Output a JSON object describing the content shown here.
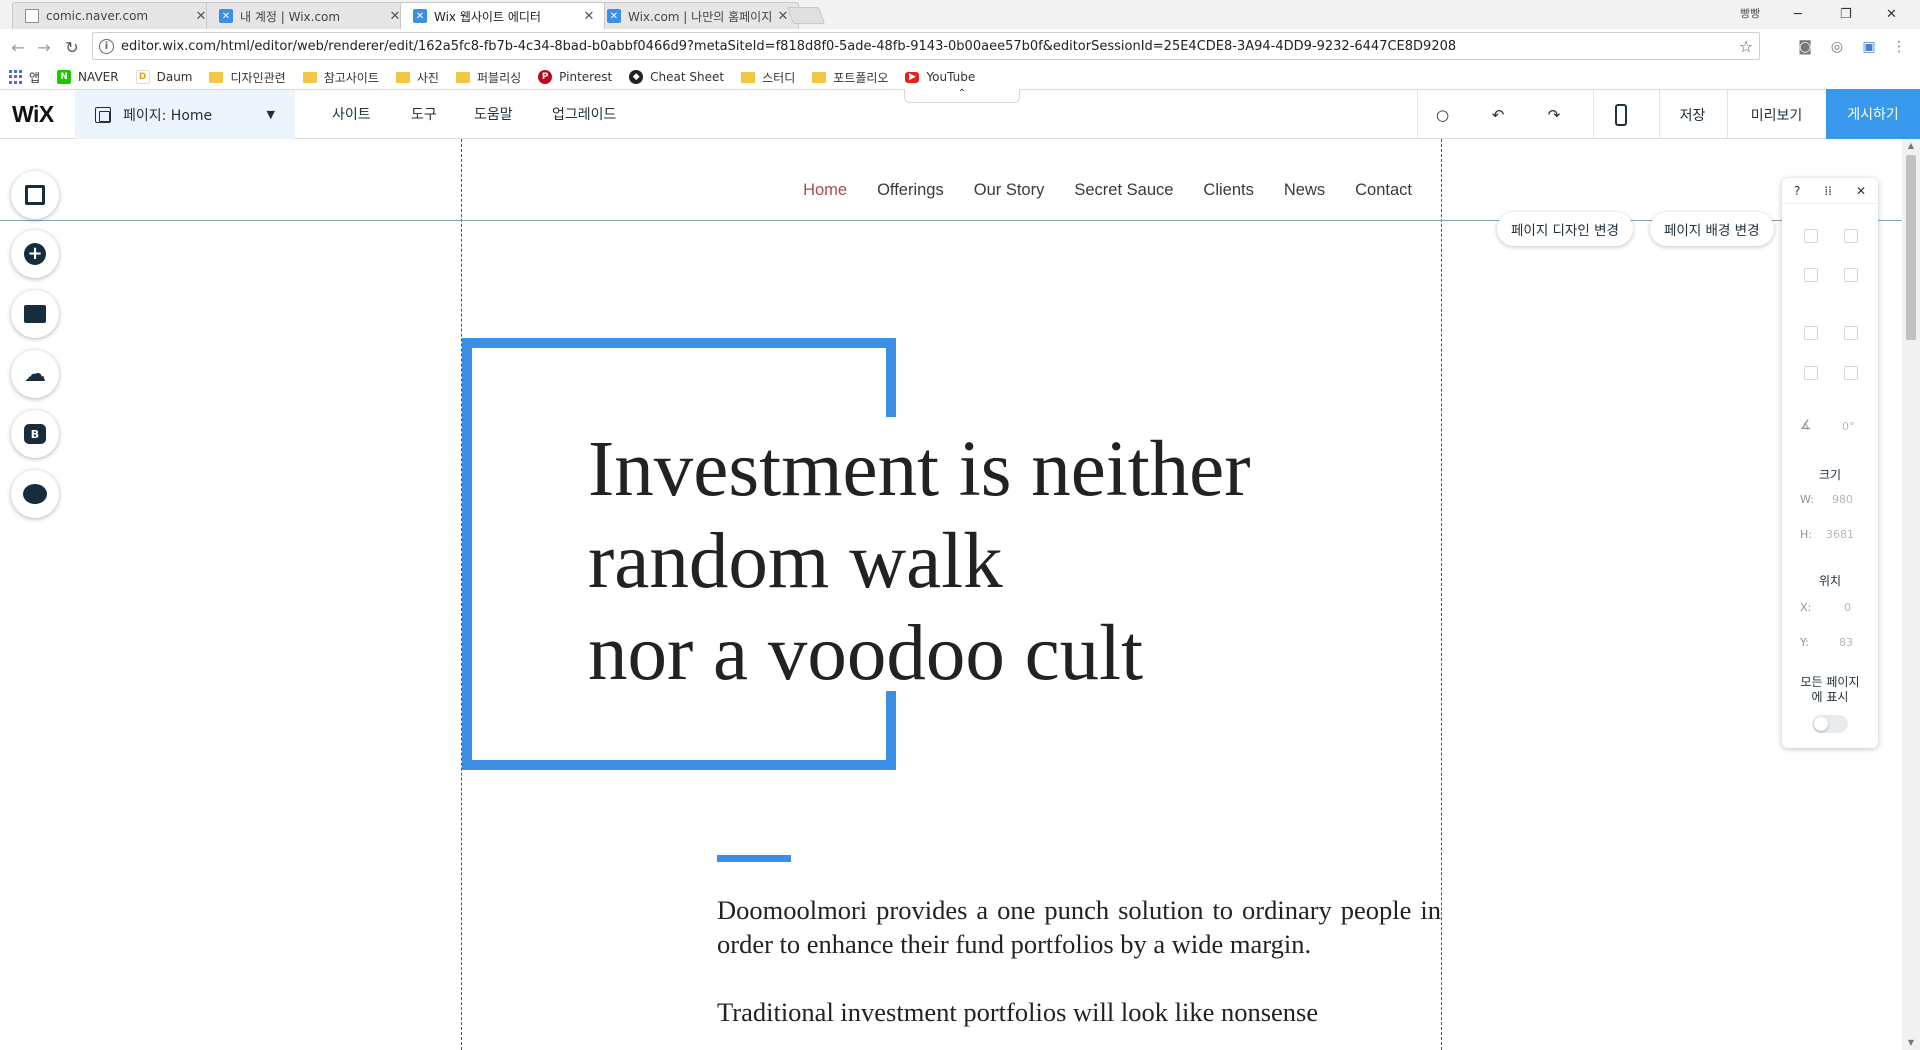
{
  "browser": {
    "tabs": [
      {
        "title": "comic.naver.com",
        "favicon": "page-icon"
      },
      {
        "title": "내 계정 | Wix.com",
        "favicon": "wix-icon"
      },
      {
        "title": "Wix 웹사이트 에디터",
        "favicon": "wix-icon",
        "active": true
      },
      {
        "title": "Wix.com | 나만의 홈페이지",
        "favicon": "wix-icon"
      }
    ],
    "profile": "빵빵",
    "address": "editor.wix.com/html/editor/web/renderer/edit/162a5fc8-fb7b-4c34-8bad-b0abbf0466d9?metaSiteId=f818d8f0-5ade-48fb-9143-0b00aee57b0f&editorSessionId=25E4CDE8-3A94-4DD9-9232-6447CE8D9208",
    "bookmarks": [
      {
        "label": "앱",
        "icon": "apps-icon"
      },
      {
        "label": "NAVER",
        "icon": "naver-icon"
      },
      {
        "label": "Daum",
        "icon": "daum-icon"
      },
      {
        "label": "디자인관련",
        "icon": "folder-icon"
      },
      {
        "label": "참고사이트",
        "icon": "folder-icon"
      },
      {
        "label": "사진",
        "icon": "folder-icon"
      },
      {
        "label": "퍼블리싱",
        "icon": "folder-icon"
      },
      {
        "label": "Pinterest",
        "icon": "pinterest-icon"
      },
      {
        "label": "Cheat Sheet",
        "icon": "cheat-sheet-icon"
      },
      {
        "label": "스터디",
        "icon": "folder-icon"
      },
      {
        "label": "포트폴리오",
        "icon": "folder-icon"
      },
      {
        "label": "YouTube",
        "icon": "youtube-icon"
      }
    ]
  },
  "editor": {
    "logo": "WiX",
    "page_selector": "페이지: Home",
    "menu": [
      "사이트",
      "도구",
      "도움말",
      "업그레이드"
    ],
    "save": "저장",
    "preview": "미리보기",
    "publish": "게시하기",
    "accent_color": "#3899ec"
  },
  "site": {
    "nav": [
      "Home",
      "Offerings",
      "Our Story",
      "Secret Sauce",
      "Clients",
      "News",
      "Contact"
    ],
    "headline": [
      "Investment is neither",
      "random walk",
      "nor a voodoo cult"
    ],
    "body": [
      "Doomoolmori provides a one punch solution to ordinary people in order to enhance their fund portfolios by a wide margin.",
      "Traditional investment portfolios will look like nonsense"
    ],
    "frame_color": "#3b8fe4"
  },
  "canvas_buttons": {
    "page_design": "페이지 디자인 변경",
    "page_background": "페이지 배경 변경"
  },
  "inspector": {
    "help": "?",
    "rotation": "0°",
    "size_label": "크기",
    "w_label": "W:",
    "w_value": "980",
    "h_label": "H:",
    "h_value": "3681",
    "position_label": "위치",
    "x_label": "X:",
    "x_value": "0",
    "y_label": "Y:",
    "y_value": "83",
    "show_all_pages": "모든 페이지\n에 표시"
  }
}
